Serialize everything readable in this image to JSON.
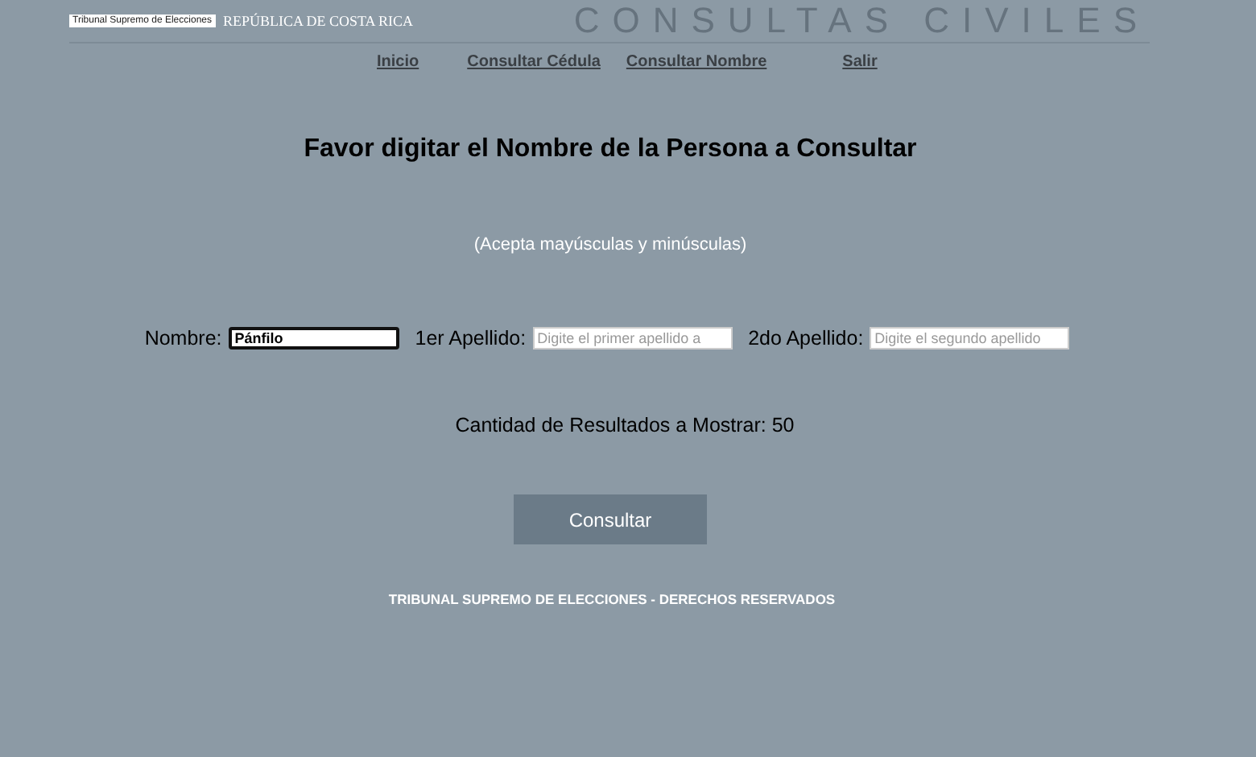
{
  "header": {
    "logo_text": "Tribunal Supremo de Elecciones",
    "country": "REPÚBLICA DE COSTA RICA",
    "title": "CONSULTAS CIVILES"
  },
  "nav": [
    {
      "label": "Inicio"
    },
    {
      "label": "Consultar Cédula"
    },
    {
      "label": "Consultar Nombre"
    },
    {
      "label": "Salir"
    }
  ],
  "heading": "Favor digitar el Nombre de la Persona a Consultar",
  "hint": "(Acepta mayúsculas y minúsculas)",
  "fields": [
    {
      "label": "Nombre:",
      "value": "Pánfilo",
      "focused": true
    },
    {
      "label": "1er Apellido:",
      "placeholder": "Digite el primer apellido a",
      "focused": false
    },
    {
      "label": "2do Apellido:",
      "placeholder": "Digite el segundo apellido",
      "focused": false
    }
  ],
  "results_count": "Cantidad de Resultados a Mostrar: 50",
  "submit": "Consultar",
  "footer": "TRIBUNAL SUPREMO DE ELECCIONES - DERECHOS RESERVADOS"
}
